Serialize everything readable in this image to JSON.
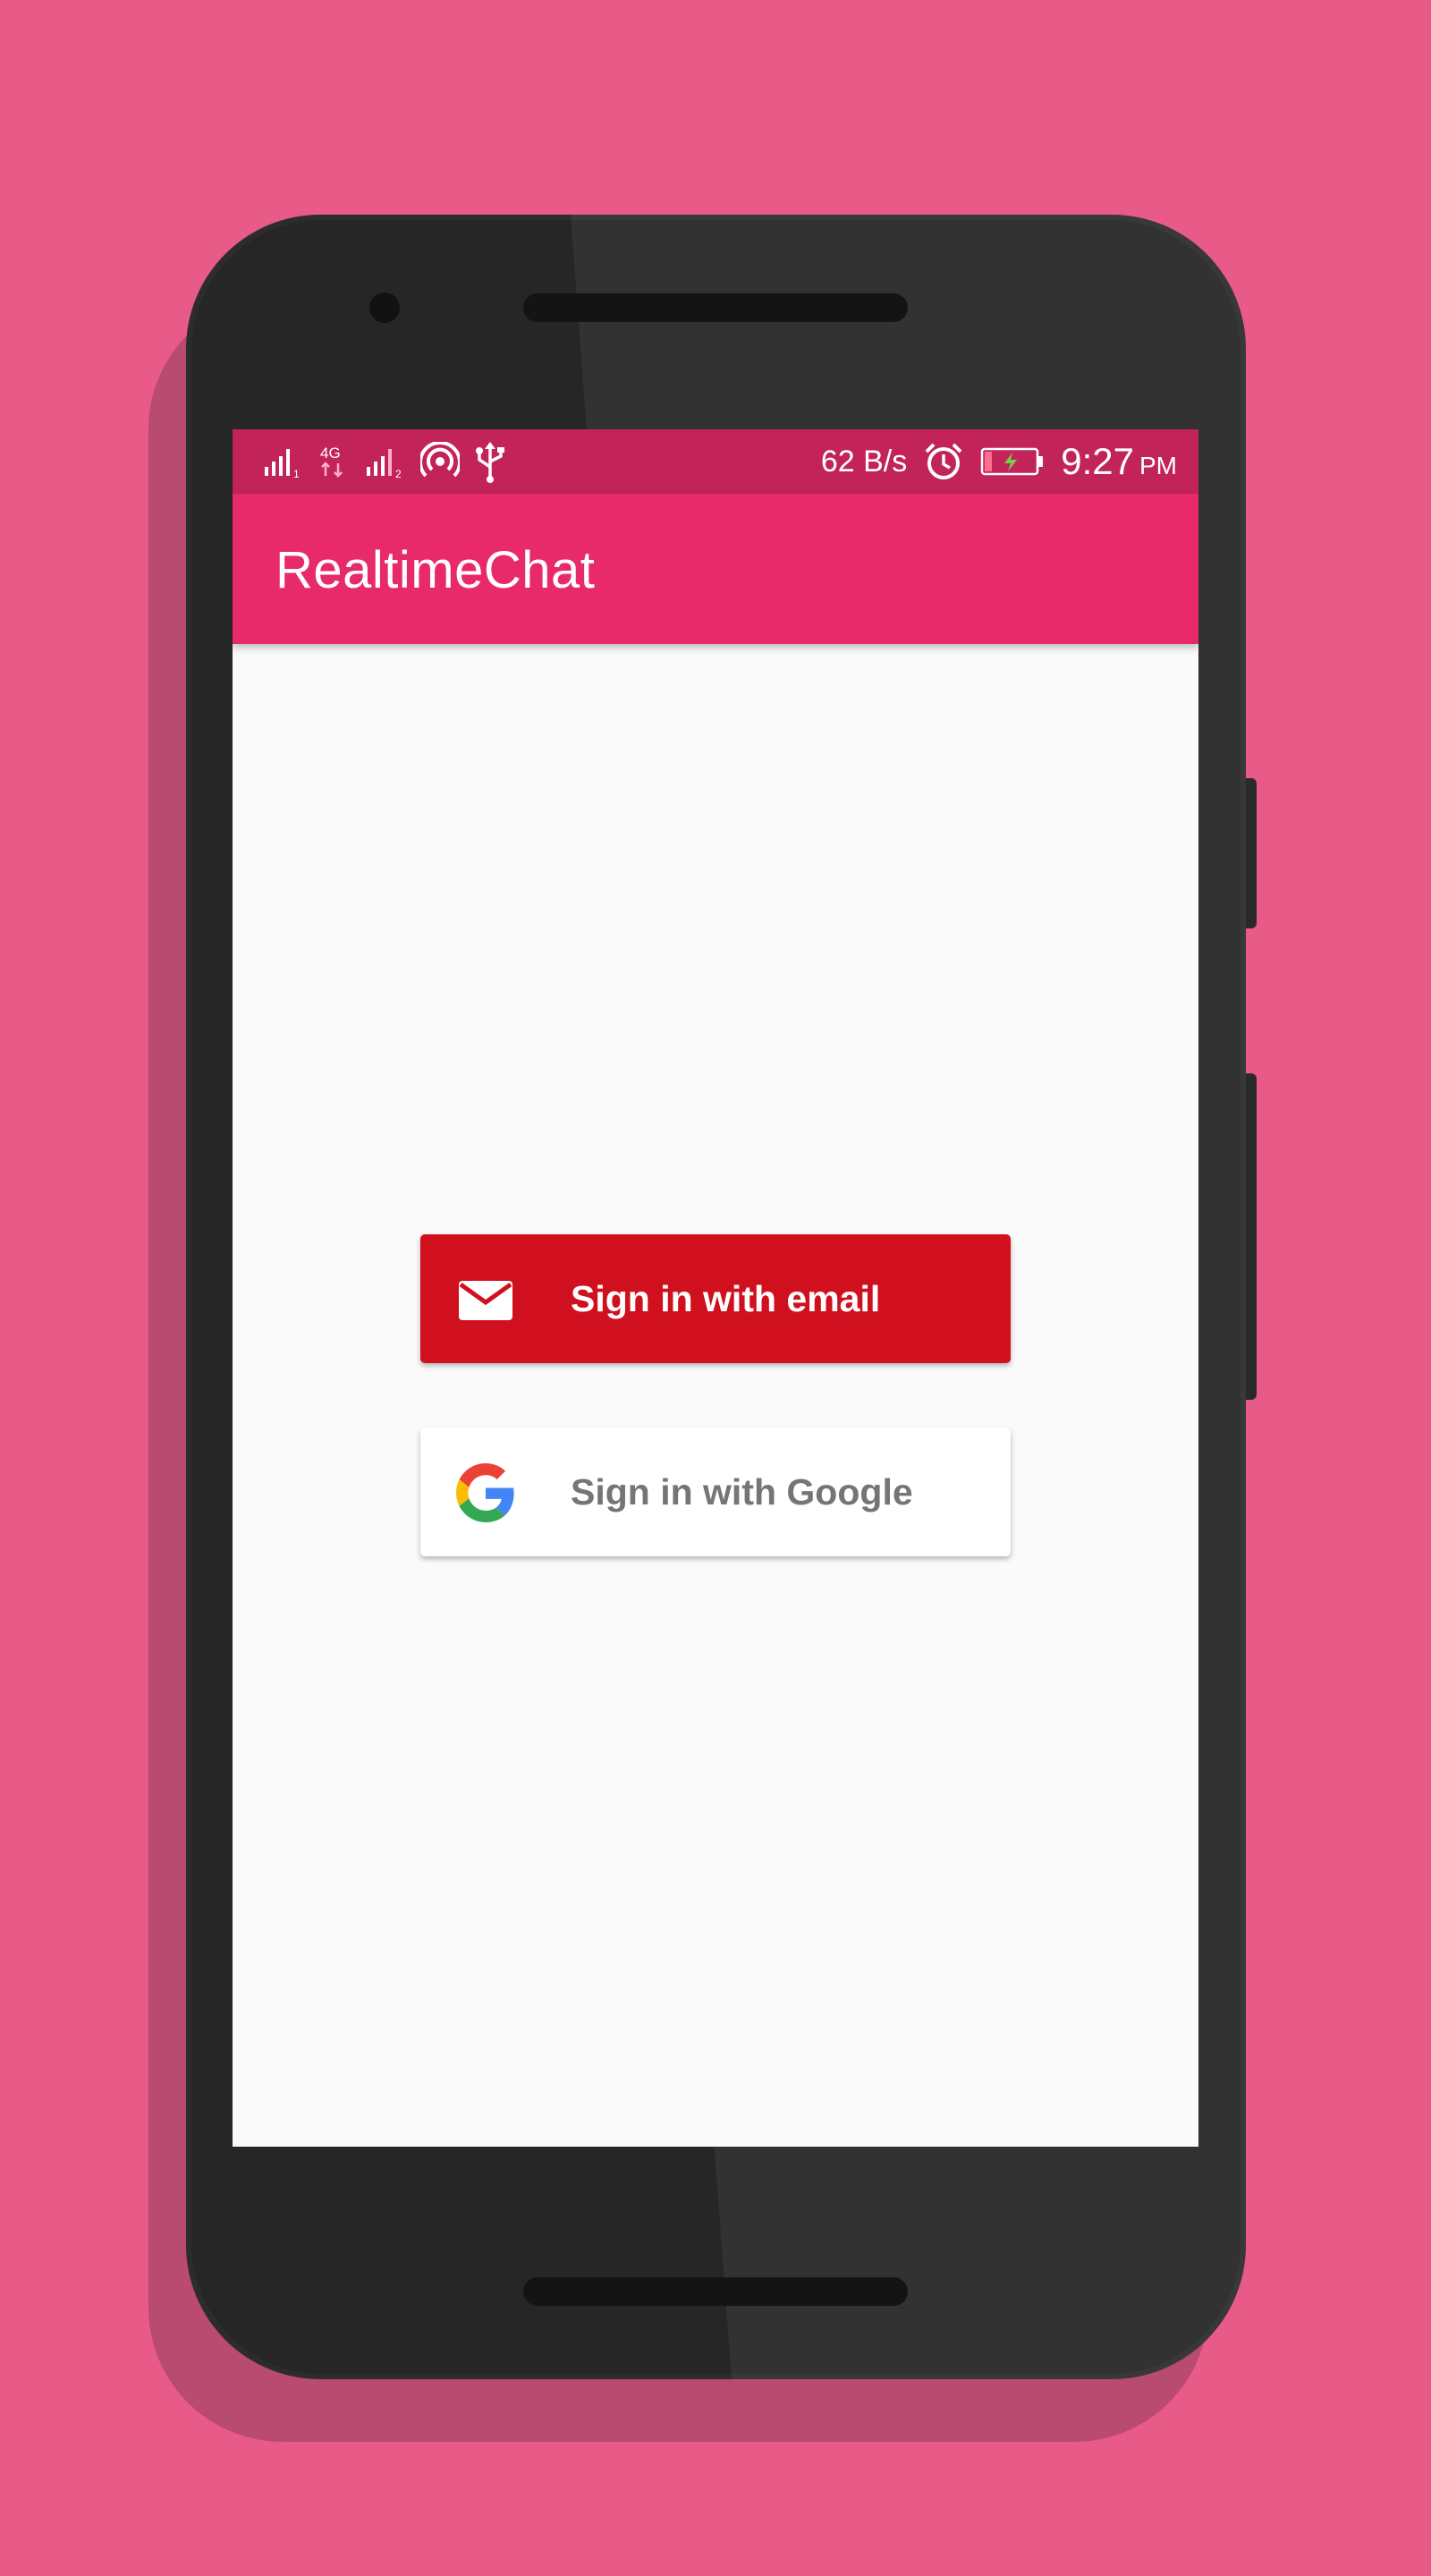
{
  "status_bar": {
    "net_speed": "62 B/s",
    "time": "9:27",
    "time_suffix": "PM",
    "network_type": "4G",
    "sim1": "1",
    "sim2": "2",
    "icons": [
      "signal-sim1-icon",
      "data-4g-icon",
      "signal-sim2-icon",
      "hotspot-icon",
      "usb-icon",
      "alarm-icon",
      "battery-charging-icon"
    ]
  },
  "app_bar": {
    "title": "RealtimeChat"
  },
  "sign_in": {
    "email_label": "Sign in with email",
    "google_label": "Sign in with Google"
  },
  "colors": {
    "background": "#e85a88",
    "app_bar": "#e8296a",
    "status_bar": "#c2245a",
    "email_button": "#d0101e",
    "google_button": "#ffffff"
  }
}
